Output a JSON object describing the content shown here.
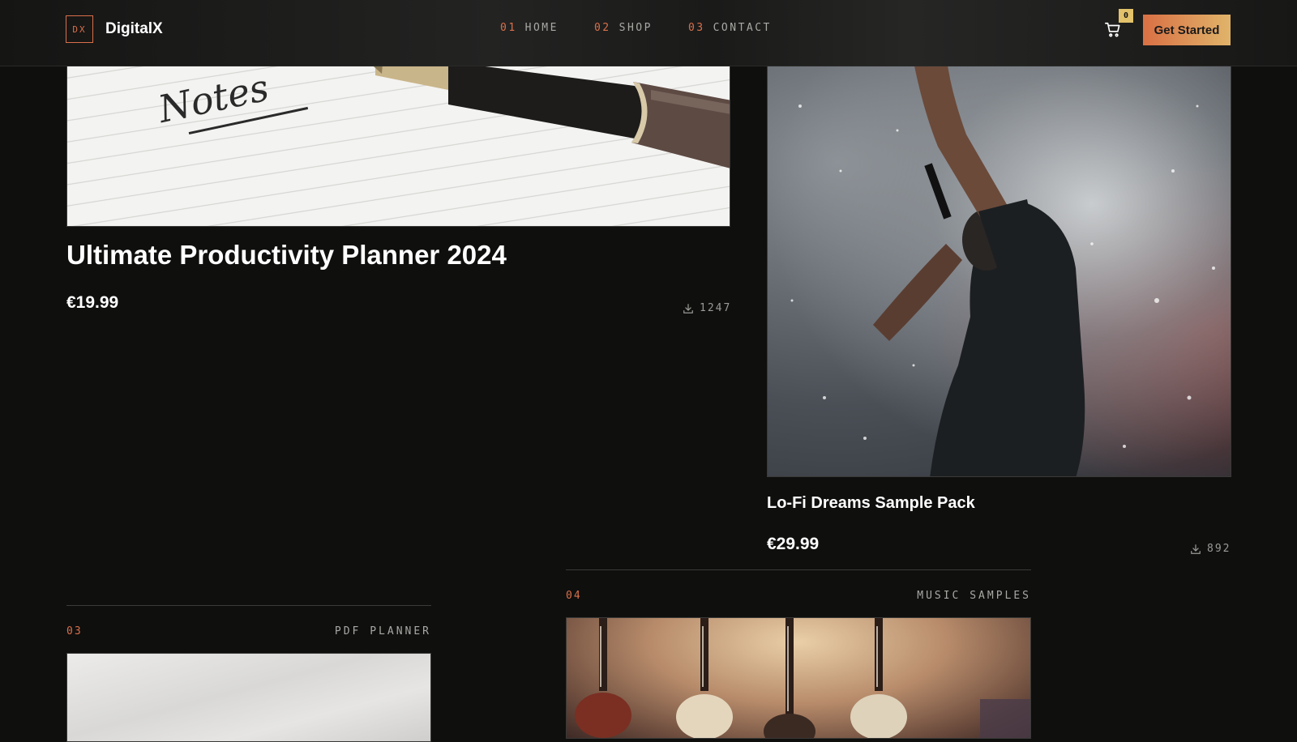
{
  "header": {
    "logo_mark": "DX",
    "brand": "DigitalX",
    "nav": [
      {
        "num": "01",
        "label": "HOME"
      },
      {
        "num": "02",
        "label": "SHOP"
      },
      {
        "num": "03",
        "label": "CONTACT"
      }
    ],
    "cart_count": "0",
    "cta_label": "Get Started"
  },
  "products": {
    "p1": {
      "title": "Ultimate Productivity Planner 2024",
      "price": "€19.99",
      "downloads": "1247",
      "image_text": "Notes"
    },
    "p2": {
      "title": "Lo-Fi Dreams Sample Pack",
      "price": "€29.99",
      "downloads": "892"
    }
  },
  "cards": {
    "c3": {
      "num": "03",
      "category": "PDF PLANNER"
    },
    "c4": {
      "num": "04",
      "category": "MUSIC SAMPLES"
    }
  },
  "colors": {
    "background": "#0f0f0e",
    "accent": "#d8704a",
    "cta_gradient_start": "#d97044",
    "cta_gradient_end": "#e0b46a",
    "badge": "#e2c26a"
  },
  "icons": [
    "cart-icon",
    "download-icon"
  ]
}
